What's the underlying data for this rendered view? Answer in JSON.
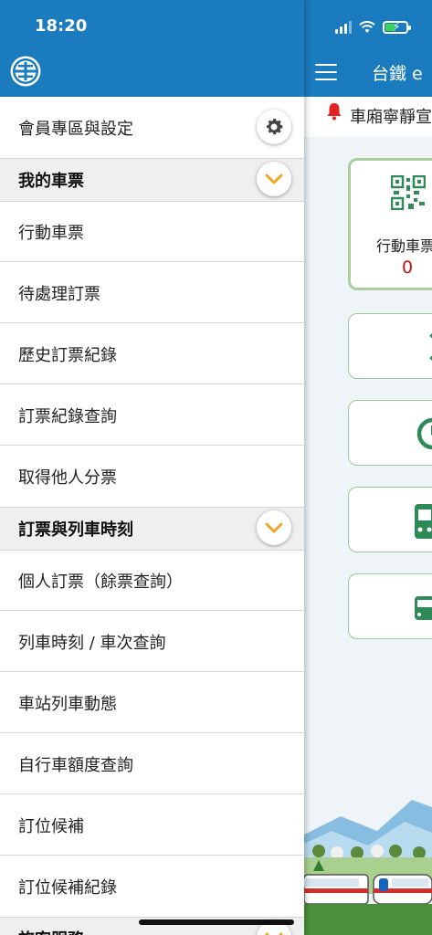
{
  "status_bar": {
    "time": "18:20"
  },
  "app": {
    "title": "台鐵 e",
    "notice": "車廂寧靜宣",
    "mobile_ticket_card": {
      "label": "行動車票",
      "count": "0"
    }
  },
  "drawer": {
    "member_label": "會員專區與設定",
    "sections": [
      {
        "title": "我的車票",
        "items": [
          "行動車票",
          "待處理訂票",
          "歷史訂票紀錄",
          "訂票紀錄查詢",
          "取得他人分票"
        ]
      },
      {
        "title": "訂票與列車時刻",
        "items": [
          "個人訂票（餘票查詢）",
          "列車時刻 / 車次查詢",
          "車站列車動態",
          "自行車額度查詢",
          "訂位候補",
          "訂位候補紀錄"
        ]
      },
      {
        "title": "旅客服務",
        "items": []
      }
    ]
  },
  "colors": {
    "brand_blue": "#1a7bbf",
    "accent_orange": "#f3a21a",
    "card_green": "#2e8b57",
    "alert_red": "#c41010"
  }
}
